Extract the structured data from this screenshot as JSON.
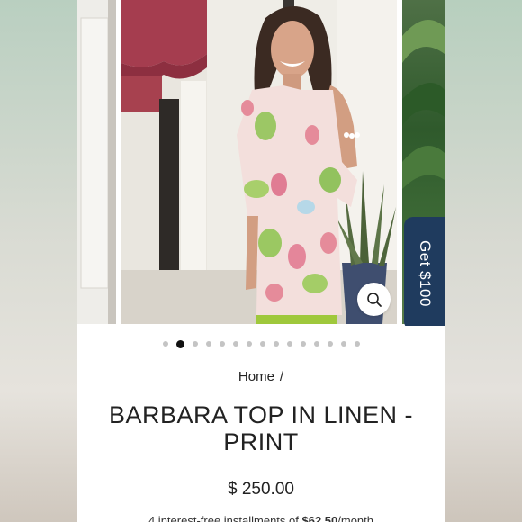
{
  "carousel": {
    "image_description": "Woman wearing a floral print linen button-up tunic top",
    "slide_count": 15,
    "active_index": 1
  },
  "zoom": {
    "icon": "magnifier-icon"
  },
  "promo": {
    "label": "Get $100"
  },
  "breadcrumb": {
    "home": "Home",
    "separator": "/"
  },
  "product": {
    "title": "BARBARA TOP IN LINEN - PRINT",
    "price": "$ 250.00",
    "installment_prefix": "4 interest-free installments of",
    "installment_amount": "$62.50",
    "installment_suffix": "/month"
  },
  "colors": {
    "promo_bg": "#1f3b5e",
    "text": "#222222",
    "dot_active": "#111111",
    "dot": "#c4c4c4"
  }
}
